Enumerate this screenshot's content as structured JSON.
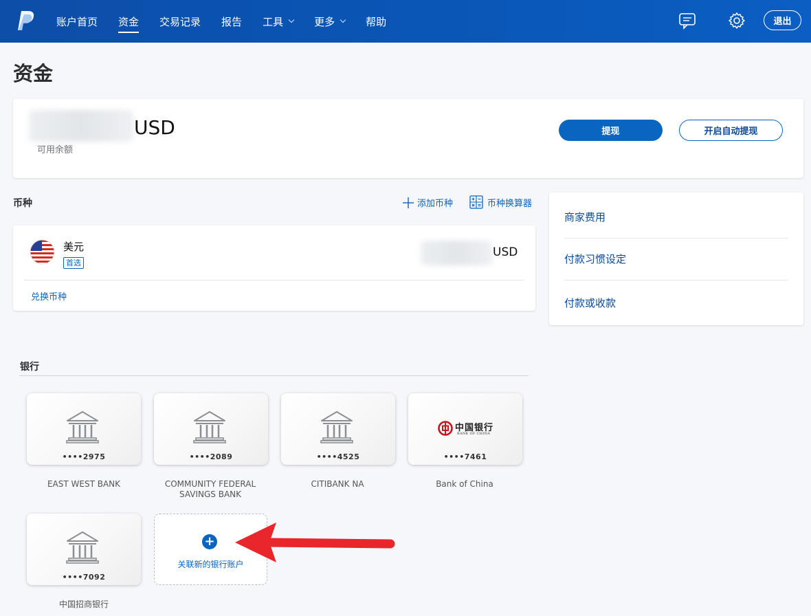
{
  "nav": {
    "items": [
      {
        "label": "账户首页",
        "active": false
      },
      {
        "label": "资金",
        "active": true
      },
      {
        "label": "交易记录",
        "active": false
      },
      {
        "label": "报告",
        "active": false
      },
      {
        "label": "工具",
        "active": false,
        "dropdown": true
      },
      {
        "label": "更多",
        "active": false,
        "dropdown": true
      },
      {
        "label": "帮助",
        "active": false
      }
    ],
    "logout_label": "退出",
    "icons": [
      "paypal-logo-icon",
      "message-center-icon",
      "gear-icon"
    ]
  },
  "page": {
    "title": "资金"
  },
  "balance": {
    "currency": "USD",
    "label": "可用余额",
    "withdraw_label": "提现",
    "auto_withdraw_label": "开启自动提现"
  },
  "currencies": {
    "section_label": "币种",
    "add_label": "添加币种",
    "calculator_label": "币种换算器",
    "items": [
      {
        "name": "美元",
        "badge": "首选",
        "currency": "USD",
        "flag_icon": "us-flag-icon"
      }
    ],
    "exchange_label": "兑换币种"
  },
  "side_links": [
    "商家费用",
    "付款习惯设定",
    "付款或收款"
  ],
  "banks": {
    "section_label": "银行",
    "items": [
      {
        "number": "••••2975",
        "name": "EAST WEST BANK",
        "icon": "bank-building-icon"
      },
      {
        "number": "••••2089",
        "name": "COMMUNITY FEDERAL SAVINGS BANK",
        "icon": "bank-building-icon"
      },
      {
        "number": "••••4525",
        "name": "CITIBANK NA",
        "icon": "bank-building-icon"
      },
      {
        "number": "••••7461",
        "name": "Bank of China",
        "icon": "bank-of-china-logo",
        "logo_text": "中国银行",
        "logo_sub": "BANK OF CHINA"
      },
      {
        "number": "••••7092",
        "name": "中国招商银行",
        "icon": "bank-building-icon"
      }
    ],
    "add_label": "关联新的银行账户"
  },
  "colors": {
    "nav_bg": "#0c4ea8",
    "accent": "#0a65c0",
    "arrow": "#e8262c"
  }
}
